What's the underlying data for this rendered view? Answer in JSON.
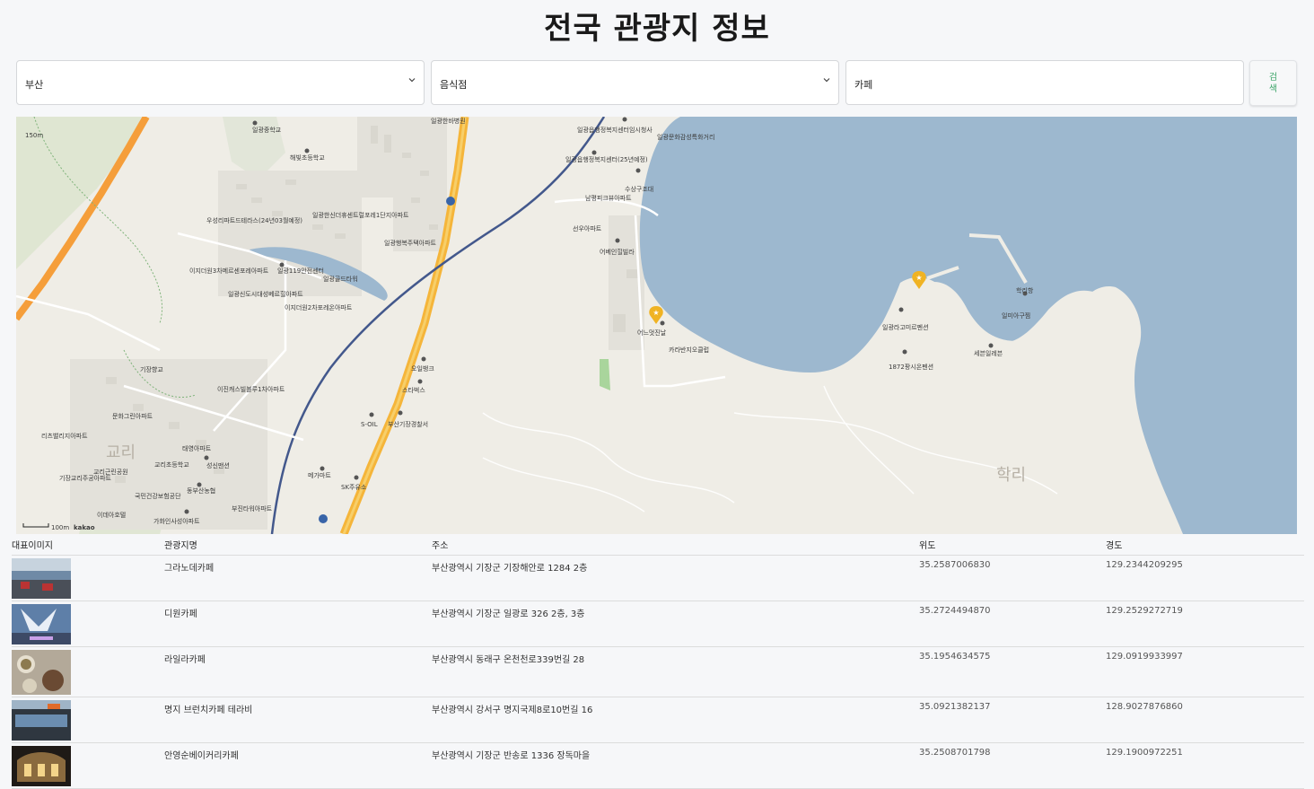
{
  "page": {
    "title": "전국 관광지 정보"
  },
  "filters": {
    "region": "부산",
    "category": "음식점",
    "keyword": "카페",
    "search_label": "검색"
  },
  "map": {
    "labels": {
      "school1": "일광중학교",
      "school2": "해빛초등학교",
      "hospital": "일광한바병원",
      "office1": "일광읍행정복지센터임시청사",
      "office2": "일광읍행정복지센터(25년예정)",
      "office3": "일광문화감성특화거리",
      "apt1": "우성리파트드테라스(24년03월예정)",
      "apt2": "일광한신더휴센트럴포레1단지아파트",
      "apt3": "일광행복주택아파트",
      "apt4": "이지더원3차메르센포레아파트",
      "fire": "일광119안전센터",
      "tower": "일광골드타워",
      "apt5": "일광신도시대성베르힐아파트",
      "apt6": "이지더원2차포레온아파트",
      "apt7": "남평피크뷰아파트",
      "apt8": "선우아파트",
      "villa": "어베인힐빌라",
      "coast": "수상구조대",
      "cafe_label": "어느멋진날",
      "club": "카라반지오클럽",
      "oil": "오일뱅크",
      "starbucks": "스타벅스",
      "soil": "S-OIL",
      "police": "부산기장경찰서",
      "mega": "메가마트",
      "sk": "SK주유소",
      "gijang": "기장향교",
      "apt9": "이진캐스빌블루1차아파트",
      "apt10": "문화그린아파트",
      "apt11": "리츠밸리지아파트",
      "park": "교리근린공원",
      "school3": "교리초등학교",
      "apt12": "태영아파트",
      "apt13": "성신맨션",
      "apt14": "기장교리주공아파트",
      "bank": "동부산농협",
      "center": "국민건강보험공단",
      "hotel": "이데아호텔",
      "apt15": "가화인사성아파트",
      "apt16": "부진타워아파트",
      "pension1": "일광라고미르펜션",
      "pension2": "1872팡시온펜션",
      "hakri_port": "학리항",
      "restaurant": "일미아구찜",
      "shop": "세븐일레븐",
      "district_gyori": "교리",
      "district_hakri": "학리",
      "scale": "100m",
      "brand": "kakao",
      "scale_top": "150m"
    }
  },
  "table": {
    "headers": [
      "대표이미지",
      "관광지명",
      "주소",
      "위도",
      "경도"
    ],
    "rows": [
      {
        "name": "그라노데카페",
        "address": "부산광역시 기장군 기장해안로 1284 2층",
        "lat": "35.2587006830",
        "lng": "129.2344209295"
      },
      {
        "name": "디원카페",
        "address": "부산광역시 기장군 일광로 326 2층, 3층",
        "lat": "35.2724494870",
        "lng": "129.2529272719"
      },
      {
        "name": "라일라카페",
        "address": "부산광역시 동래구 온천천로339번길 28",
        "lat": "35.1954634575",
        "lng": "129.0919933997"
      },
      {
        "name": "명지 브런치카페 테라비",
        "address": "부산광역시 강서구 명지국제8로10번길 16",
        "lat": "35.0921382137",
        "lng": "128.9027876860"
      },
      {
        "name": "안영순베이커리카페",
        "address": "부산광역시 기장군 반송로 1336 장독마을",
        "lat": "35.2508701798",
        "lng": "129.1900972251"
      }
    ]
  },
  "colors": {
    "sea": "#9db8cf",
    "land": "#efede6",
    "highway": "#f59e3a",
    "railway": "#43588c",
    "marker": "#f0b323",
    "accent": "#3fa66b"
  }
}
